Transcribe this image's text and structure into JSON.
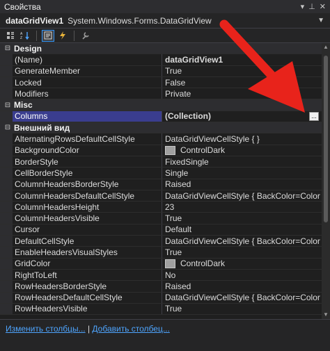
{
  "window": {
    "title": "Свойства"
  },
  "object_selector": {
    "name": "dataGridView1",
    "type": "System.Windows.Forms.DataGridView"
  },
  "toolbar": {
    "buttons": [
      {
        "icon": "categorized-icon"
      },
      {
        "icon": "alphabetical-icon"
      },
      {
        "icon": "properties-icon",
        "active": true
      },
      {
        "icon": "events-icon"
      },
      {
        "icon": "property-pages-icon"
      }
    ]
  },
  "grid": {
    "categories": [
      {
        "name": "Design",
        "expanded": true,
        "properties": [
          {
            "name": "(Name)",
            "value": "dataGridView1",
            "bold": true
          },
          {
            "name": "GenerateMember",
            "value": "True"
          },
          {
            "name": "Locked",
            "value": "False"
          },
          {
            "name": "Modifiers",
            "value": "Private"
          }
        ]
      },
      {
        "name": "Misc",
        "expanded": true,
        "properties": [
          {
            "name": "Columns",
            "value": "(Collection)",
            "bold": true,
            "selected": true,
            "has_ellipsis": true,
            "ellipsis_label": "..."
          }
        ]
      },
      {
        "name": "Внешний вид",
        "expanded": true,
        "properties": [
          {
            "name": "AlternatingRowsDefaultCellStyle",
            "value": "DataGridViewCellStyle { }"
          },
          {
            "name": "BackgroundColor",
            "value": "ControlDark",
            "swatch": "#a0a0a0"
          },
          {
            "name": "BorderStyle",
            "value": "FixedSingle"
          },
          {
            "name": "CellBorderStyle",
            "value": "Single"
          },
          {
            "name": "ColumnHeadersBorderStyle",
            "value": "Raised"
          },
          {
            "name": "ColumnHeadersDefaultCellStyle",
            "value": "DataGridViewCellStyle { BackColor=Color [Contr"
          },
          {
            "name": "ColumnHeadersHeight",
            "value": "23"
          },
          {
            "name": "ColumnHeadersVisible",
            "value": "True"
          },
          {
            "name": "Cursor",
            "value": "Default"
          },
          {
            "name": "DefaultCellStyle",
            "value": "DataGridViewCellStyle { BackColor=Color [Windo"
          },
          {
            "name": "EnableHeadersVisualStyles",
            "value": "True"
          },
          {
            "name": "GridColor",
            "value": "ControlDark",
            "swatch": "#a0a0a0"
          },
          {
            "name": "RightToLeft",
            "value": "No"
          },
          {
            "name": "RowHeadersBorderStyle",
            "value": "Raised"
          },
          {
            "name": "RowHeadersDefaultCellStyle",
            "value": "DataGridViewCellStyle { BackColor=Color [Contr"
          },
          {
            "name": "RowHeadersVisible",
            "value": "True"
          }
        ]
      }
    ]
  },
  "commands": {
    "edit_columns": "Изменить столбцы...",
    "separator": "|",
    "add_column": "Добавить столбец..."
  },
  "colors": {
    "selection": "#3a3d8f",
    "arrow": "#e8231b",
    "link": "#4ea5ff"
  }
}
